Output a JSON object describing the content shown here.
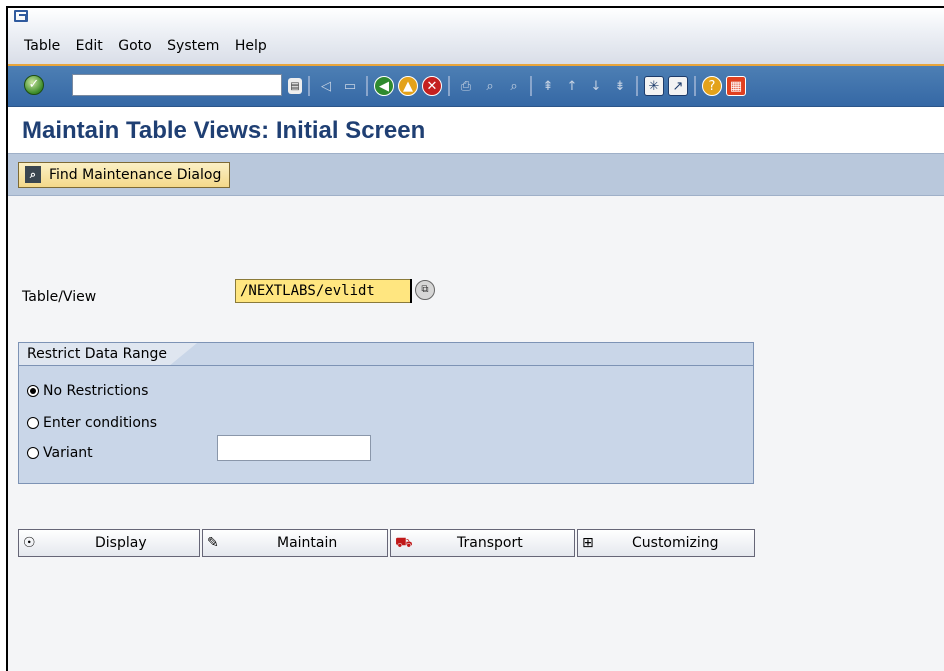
{
  "window": {
    "menu": [
      "Table",
      "Edit",
      "Goto",
      "System",
      "Help"
    ]
  },
  "toolbar": {
    "command_value": "",
    "icons": [
      "enter-icon",
      "save-icon",
      "back-icon",
      "exit-icon",
      "cancel-icon",
      "print-icon",
      "find-icon",
      "find-next-icon",
      "first-page-icon",
      "prev-page-icon",
      "next-page-icon",
      "last-page-icon",
      "new-session-icon",
      "shortcut-icon",
      "help-icon",
      "customize-layout-icon"
    ]
  },
  "page": {
    "title": "Maintain Table Views: Initial Screen",
    "find_button": "Find Maintenance Dialog"
  },
  "form": {
    "table_view_label": "Table/View",
    "table_view_value": "/NEXTLABS/evlidt",
    "restrict_title": "Restrict Data Range",
    "options": [
      {
        "label": "No Restrictions",
        "selected": true
      },
      {
        "label": "Enter conditions",
        "selected": false
      },
      {
        "label": "Variant",
        "selected": false
      }
    ],
    "variant_value": ""
  },
  "actions": {
    "display": "Display",
    "maintain": "Maintain",
    "transport": "Transport",
    "customizing": "Customizing"
  },
  "colors": {
    "title": "#1f3f73",
    "toolbar": "#3568a5",
    "input_highlight": "#ffe680",
    "group_bg": "#c9d6e8"
  }
}
